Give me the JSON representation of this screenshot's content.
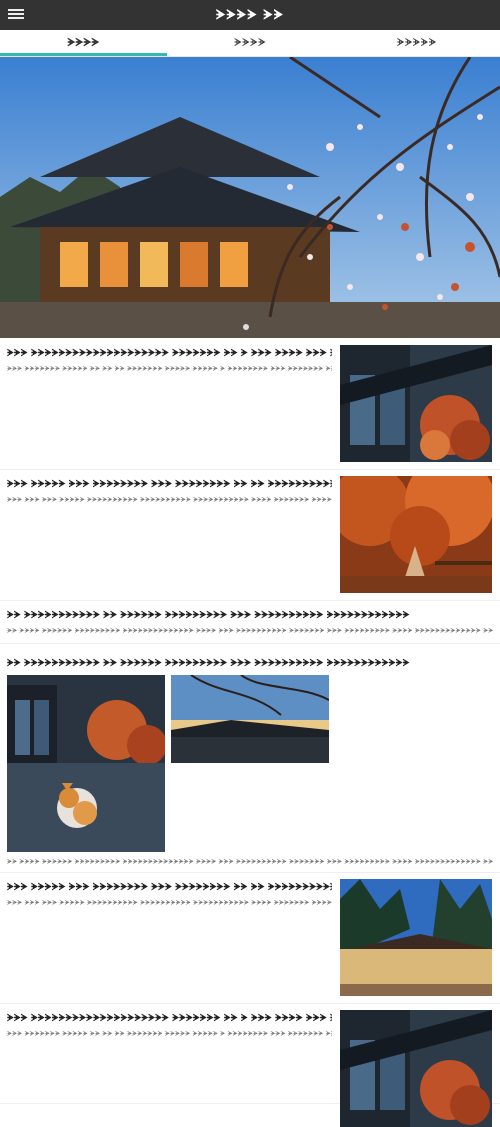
{
  "header": {
    "title": "ᗘᗘᗘᗘ ᗘᗘ",
    "menu_icon": "hamburger-menu-icon"
  },
  "tabs": [
    {
      "label": "ᗘᗘᗘᗘ"
    },
    {
      "label": "ᗘᗘᗘᗘ"
    },
    {
      "label": "ᗘᗘᗘᗘᗘ"
    }
  ],
  "articles": [
    {
      "title": "ᗘᗘᗘ ᗘᗘᗘᗘᗘᗘᗘᗘᗘᗘᗘᗘᗘᗘᗘᗘᗘᗘᗘᗘ ᗘᗘᗘᗘᗘᗘᗘ ᗘᗘ ᗘ ᗘᗘᗘ ᗘᗘᗘᗘ ᗘᗘᗘ ᗘᗘᗘᗘ ᗘᗘ ᗘᗘ",
      "desc": "ᗘᗘᗘ ᗘᗘᗘᗘᗘᗘᗘ ᗘᗘᗘᗘᗘ ᗘᗘ ᗘᗘ ᗘᗘ ᗘᗘᗘᗘᗘᗘᗘ ᗘᗘᗘᗘᗘ ᗘᗘᗘᗘᗘ ᗘ ᗘᗘᗘᗘᗘᗘᗘᗘ ᗘᗘᗘ ᗘᗘᗘᗘᗘᗘᗘ ᗘᗘᗘᗘ ᗘᗘᗘᗘᗘ ᗘᗘᗘ ᗘᗘᗘᗘ"
    },
    {
      "title": "ᗘᗘᗘ ᗘᗘᗘᗘᗘ ᗘᗘᗘ ᗘᗘᗘᗘᗘᗘᗘᗘ ᗘᗘᗘ ᗘᗘᗘᗘᗘᗘᗘᗘ ᗘᗘ ᗘᗘ ᗘᗘᗘᗘᗘᗘᗘᗘᗘᗘᗘᗘ ᗘᗘᗘᗘᗘᗘ",
      "desc": "ᗘᗘᗘ ᗘᗘᗘ ᗘᗘᗘ ᗘᗘᗘᗘᗘ ᗘᗘᗘᗘᗘᗘᗘᗘᗘᗘ ᗘᗘᗘᗘᗘᗘᗘᗘᗘᗘ ᗘᗘᗘᗘᗘᗘᗘᗘᗘᗘᗘ ᗘᗘᗘᗘ ᗘᗘᗘᗘᗘᗘᗘ ᗘᗘᗘᗘᗘᗘᗘ ᗘᗘ ᗘᗘ ᗘᗘᗘᗘᗘ"
    },
    {
      "title": "ᗘᗘ ᗘᗘᗘᗘᗘᗘᗘᗘᗘᗘᗘ ᗘᗘ ᗘᗘᗘᗘᗘᗘ ᗘᗘᗘᗘᗘᗘᗘᗘᗘ ᗘᗘᗘ ᗘᗘᗘᗘᗘᗘᗘᗘᗘᗘ ᗘᗘᗘᗘᗘᗘᗘᗘᗘᗘᗘᗘ",
      "desc": "ᗘᗘ ᗘᗘᗘᗘ ᗘᗘᗘᗘᗘᗘ ᗘᗘᗘᗘᗘᗘᗘᗘᗘ ᗘᗘᗘᗘᗘᗘᗘᗘᗘᗘᗘᗘᗘᗘ ᗘᗘᗘᗘ ᗘᗘᗘ ᗘᗘᗘᗘᗘᗘᗘᗘᗘᗘ ᗘᗘᗘᗘᗘᗘᗘ ᗘᗘᗘ ᗘᗘᗘᗘᗘᗘᗘᗘᗘ ᗘᗘᗘᗘ ᗘᗘᗘᗘᗘᗘᗘᗘᗘᗘᗘᗘᗘ ᗘᗘᗘ ᗘᗘᗘᗘᗘᗘᗘᗘ"
    },
    {
      "title": "ᗘᗘ ᗘᗘᗘᗘᗘᗘᗘᗘᗘᗘᗘ ᗘᗘ ᗘᗘᗘᗘᗘᗘ ᗘᗘᗘᗘᗘᗘᗘᗘᗘ ᗘᗘᗘ ᗘᗘᗘᗘᗘᗘᗘᗘᗘᗘ ᗘᗘᗘᗘᗘᗘᗘᗘᗘᗘᗘᗘ",
      "desc": "ᗘᗘ ᗘᗘᗘᗘ ᗘᗘᗘᗘᗘᗘ ᗘᗘᗘᗘᗘᗘᗘᗘᗘ ᗘᗘᗘᗘᗘᗘᗘᗘᗘᗘᗘᗘᗘᗘ ᗘᗘᗘᗘ ᗘᗘᗘ ᗘᗘᗘᗘᗘᗘᗘᗘᗘᗘ ᗘᗘᗘᗘᗘᗘᗘ ᗘᗘᗘ ᗘᗘᗘᗘᗘᗘᗘᗘᗘ ᗘᗘᗘᗘ ᗘᗘᗘᗘᗘᗘᗘᗘᗘᗘᗘᗘᗘ ᗘᗘᗘ ᗘᗘᗘᗘᗘᗘᗘᗘ"
    },
    {
      "title": "ᗘᗘᗘ ᗘᗘᗘᗘᗘ ᗘᗘᗘ ᗘᗘᗘᗘᗘᗘᗘᗘ ᗘᗘᗘ ᗘᗘᗘᗘᗘᗘᗘᗘ ᗘᗘ ᗘᗘ ᗘᗘᗘᗘᗘᗘᗘᗘᗘᗘᗘᗘ ᗘᗘᗘᗘᗘᗘ",
      "desc": "ᗘᗘᗘ ᗘᗘᗘ ᗘᗘᗘ ᗘᗘᗘᗘᗘ ᗘᗘᗘᗘᗘᗘᗘᗘᗘᗘ ᗘᗘᗘᗘᗘᗘᗘᗘᗘᗘ ᗘᗘᗘᗘᗘᗘᗘᗘᗘᗘᗘ ᗘᗘᗘᗘ ᗘᗘᗘᗘᗘᗘᗘ ᗘᗘᗘᗘᗘᗘᗘ ᗘᗘ ᗘᗘ ᗘᗘᗘᗘᗘ"
    },
    {
      "title": "ᗘᗘᗘ ᗘᗘᗘᗘᗘᗘᗘᗘᗘᗘᗘᗘᗘᗘᗘᗘᗘᗘᗘᗘ ᗘᗘᗘᗘᗘᗘᗘ ᗘᗘ ᗘ ᗘᗘᗘ ᗘᗘᗘᗘ ᗘᗘᗘ ᗘᗘᗘᗘ ᗘᗘ ᗘᗘ",
      "desc": "ᗘᗘᗘ ᗘᗘᗘᗘᗘᗘᗘ ᗘᗘᗘᗘᗘ ᗘᗘ ᗘᗘ ᗘᗘ ᗘᗘᗘᗘᗘᗘᗘ ᗘᗘᗘᗘᗘ ᗘᗘᗘᗘᗘ ᗘ ᗘᗘᗘᗘᗘᗘᗘᗘ ᗘᗘᗘ ᗘᗘᗘᗘᗘᗘᗘ ᗘᗘᗘᗘ ᗘᗘᗘᗘᗘ ᗘᗘᗘ ᗘᗘᗘᗘ"
    }
  ],
  "colors": {
    "topbar": "#333333",
    "tab_accent": "#35b8b0"
  }
}
